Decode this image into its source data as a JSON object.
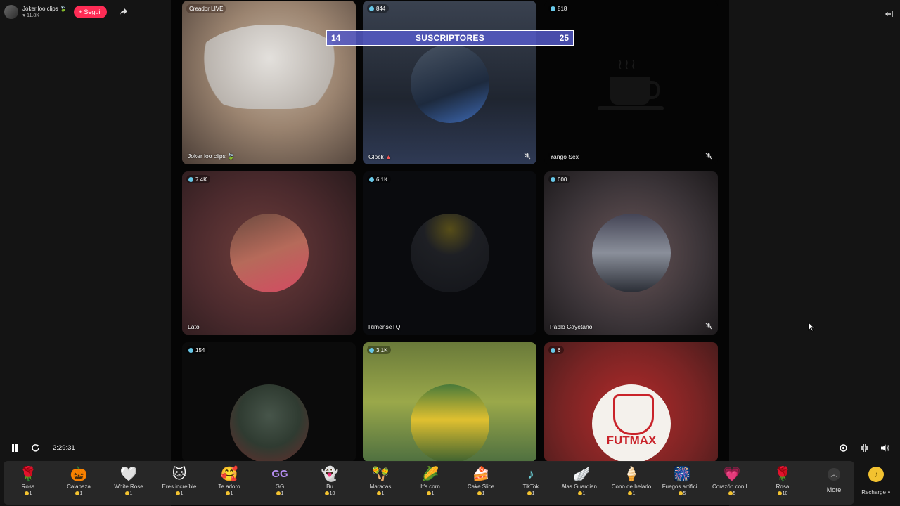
{
  "host": {
    "name": "Joker loo clips",
    "likes": "11.8K",
    "follow_label": "+ Seguir"
  },
  "scoreboard": {
    "left": "14",
    "title": "SUSCRIPTORES",
    "right": "25"
  },
  "tiles": [
    {
      "tag": "Creador LIVE",
      "name": "Joker loo clips",
      "muted": false
    },
    {
      "viewers": "844",
      "name": "Glock",
      "muted": true
    },
    {
      "viewers": "818",
      "name": "Yango Sex",
      "muted": true
    },
    {
      "viewers": "7.4K",
      "name": "Lato",
      "muted": false
    },
    {
      "viewers": "6.1K",
      "name": "RimenseTQ",
      "muted": false
    },
    {
      "viewers": "600",
      "name": "Pablo Cayetano",
      "muted": true
    },
    {
      "viewers": "154",
      "name": "",
      "muted": false
    },
    {
      "viewers": "3.1K",
      "name": "",
      "muted": false
    },
    {
      "viewers": "6",
      "name": "",
      "muted": false,
      "logo_text": "FUTMAX"
    }
  ],
  "player": {
    "time": "2:29:31"
  },
  "gifts": [
    {
      "name": "Rosa",
      "price": "1",
      "icon": "🌹"
    },
    {
      "name": "Calabaza",
      "price": "1",
      "icon": "🎃"
    },
    {
      "name": "White Rose",
      "price": "1",
      "icon": "🤍"
    },
    {
      "name": "Eres increíble",
      "price": "1",
      "icon": "🐱"
    },
    {
      "name": "Te adoro",
      "price": "1",
      "icon": "🥰"
    },
    {
      "name": "GG",
      "price": "1",
      "icon": "GG"
    },
    {
      "name": "Bu",
      "price": "10",
      "icon": "👻"
    },
    {
      "name": "Maracas",
      "price": "1",
      "icon": "🪇"
    },
    {
      "name": "It's corn",
      "price": "1",
      "icon": "🌽"
    },
    {
      "name": "Cake Slice",
      "price": "1",
      "icon": "🍰"
    },
    {
      "name": "TikTok",
      "price": "1",
      "icon": "♪"
    },
    {
      "name": "Alas Guardian...",
      "price": "1",
      "icon": "🪽"
    },
    {
      "name": "Cono de helado",
      "price": "1",
      "icon": "🍦"
    },
    {
      "name": "Fuegos artifici...",
      "price": "5",
      "icon": "🎆"
    },
    {
      "name": "Corazón con l...",
      "price": "5",
      "icon": "💗"
    },
    {
      "name": "Rosa",
      "price": "10",
      "icon": "🌹"
    }
  ],
  "more_label": "More",
  "recharge_label": "Recharge ˄"
}
